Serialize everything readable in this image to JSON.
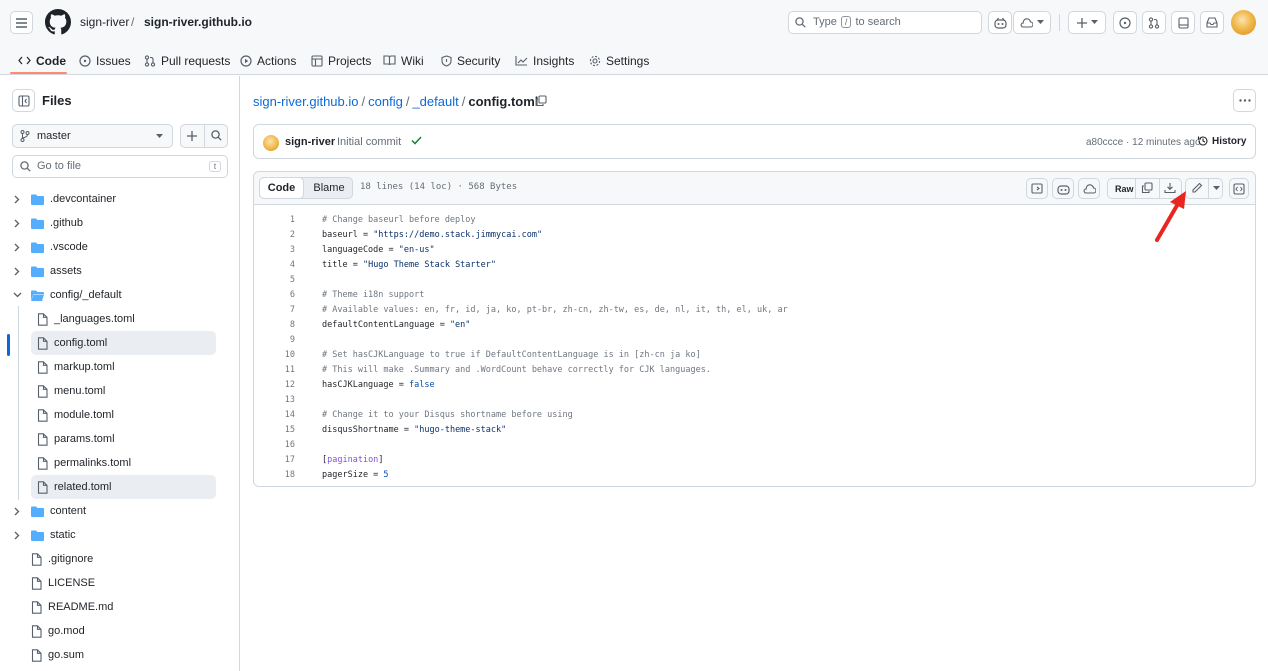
{
  "header": {
    "owner": "sign-river",
    "separator": "/",
    "repo": "sign-river.github.io",
    "search_prefix": "Type",
    "search_key": "/",
    "search_suffix": "to search"
  },
  "nav": {
    "tabs": [
      {
        "label": "Code",
        "icon": "code-icon"
      },
      {
        "label": "Issues",
        "icon": "issue-icon"
      },
      {
        "label": "Pull requests",
        "icon": "pull-request-icon"
      },
      {
        "label": "Actions",
        "icon": "play-icon"
      },
      {
        "label": "Projects",
        "icon": "table-icon"
      },
      {
        "label": "Wiki",
        "icon": "book-icon"
      },
      {
        "label": "Security",
        "icon": "shield-icon"
      },
      {
        "label": "Insights",
        "icon": "graph-icon"
      },
      {
        "label": "Settings",
        "icon": "gear-icon"
      }
    ]
  },
  "sidebar": {
    "title": "Files",
    "branch": "master",
    "go_to_file": "Go to file",
    "go_to_file_key": "t",
    "tree": [
      {
        "label": ".devcontainer",
        "type": "folder"
      },
      {
        "label": ".github",
        "type": "folder"
      },
      {
        "label": ".vscode",
        "type": "folder"
      },
      {
        "label": "assets",
        "type": "folder"
      },
      {
        "label": "config/_default",
        "type": "folder-open"
      },
      {
        "label": "_languages.toml",
        "type": "file"
      },
      {
        "label": "config.toml",
        "type": "file",
        "selected": true
      },
      {
        "label": "markup.toml",
        "type": "file"
      },
      {
        "label": "menu.toml",
        "type": "file"
      },
      {
        "label": "module.toml",
        "type": "file"
      },
      {
        "label": "params.toml",
        "type": "file"
      },
      {
        "label": "permalinks.toml",
        "type": "file"
      },
      {
        "label": "related.toml",
        "type": "file",
        "hovered": true
      },
      {
        "label": "content",
        "type": "folder"
      },
      {
        "label": "static",
        "type": "folder"
      },
      {
        "label": ".gitignore",
        "type": "file"
      },
      {
        "label": "LICENSE",
        "type": "file"
      },
      {
        "label": "README.md",
        "type": "file"
      },
      {
        "label": "go.mod",
        "type": "file"
      },
      {
        "label": "go.sum",
        "type": "file"
      }
    ]
  },
  "breadcrumb": {
    "repo": "sign-river.github.io",
    "dir1": "config",
    "dir2": "_default",
    "file": "config.toml",
    "sep": "/"
  },
  "commit": {
    "author": "sign-river",
    "message": "Initial commit",
    "meta": "a80ccce · 12 minutes ago",
    "history": "History"
  },
  "file": {
    "tab_code": "Code",
    "tab_blame": "Blame",
    "info": "18 lines (14 loc) · 568 Bytes",
    "raw": "Raw",
    "lines": [
      "# Change baseurl before deploy",
      "baseurl = \"https://demo.stack.jimmycai.com\"",
      "languageCode = \"en-us\"",
      "title = \"Hugo Theme Stack Starter\"",
      "",
      "# Theme i18n support",
      "# Available values: en, fr, id, ja, ko, pt-br, zh-cn, zh-tw, es, de, nl, it, th, el, uk, ar",
      "defaultContentLanguage = \"en\"",
      "",
      "# Set hasCJKLanguage to true if DefaultContentLanguage is in [zh-cn ja ko]",
      "# This will make .Summary and .WordCount behave correctly for CJK languages.",
      "hasCJKLanguage = false",
      "",
      "# Change it to your Disqus shortname before using",
      "disqusShortname = \"hugo-theme-stack\"",
      "",
      "[pagination]",
      "pagerSize = 5"
    ]
  },
  "colors": {
    "link": "#0969da",
    "folder": "#54aeff",
    "tab_underline": "#fd8c73",
    "annotation_arrow": "#e8261f"
  }
}
